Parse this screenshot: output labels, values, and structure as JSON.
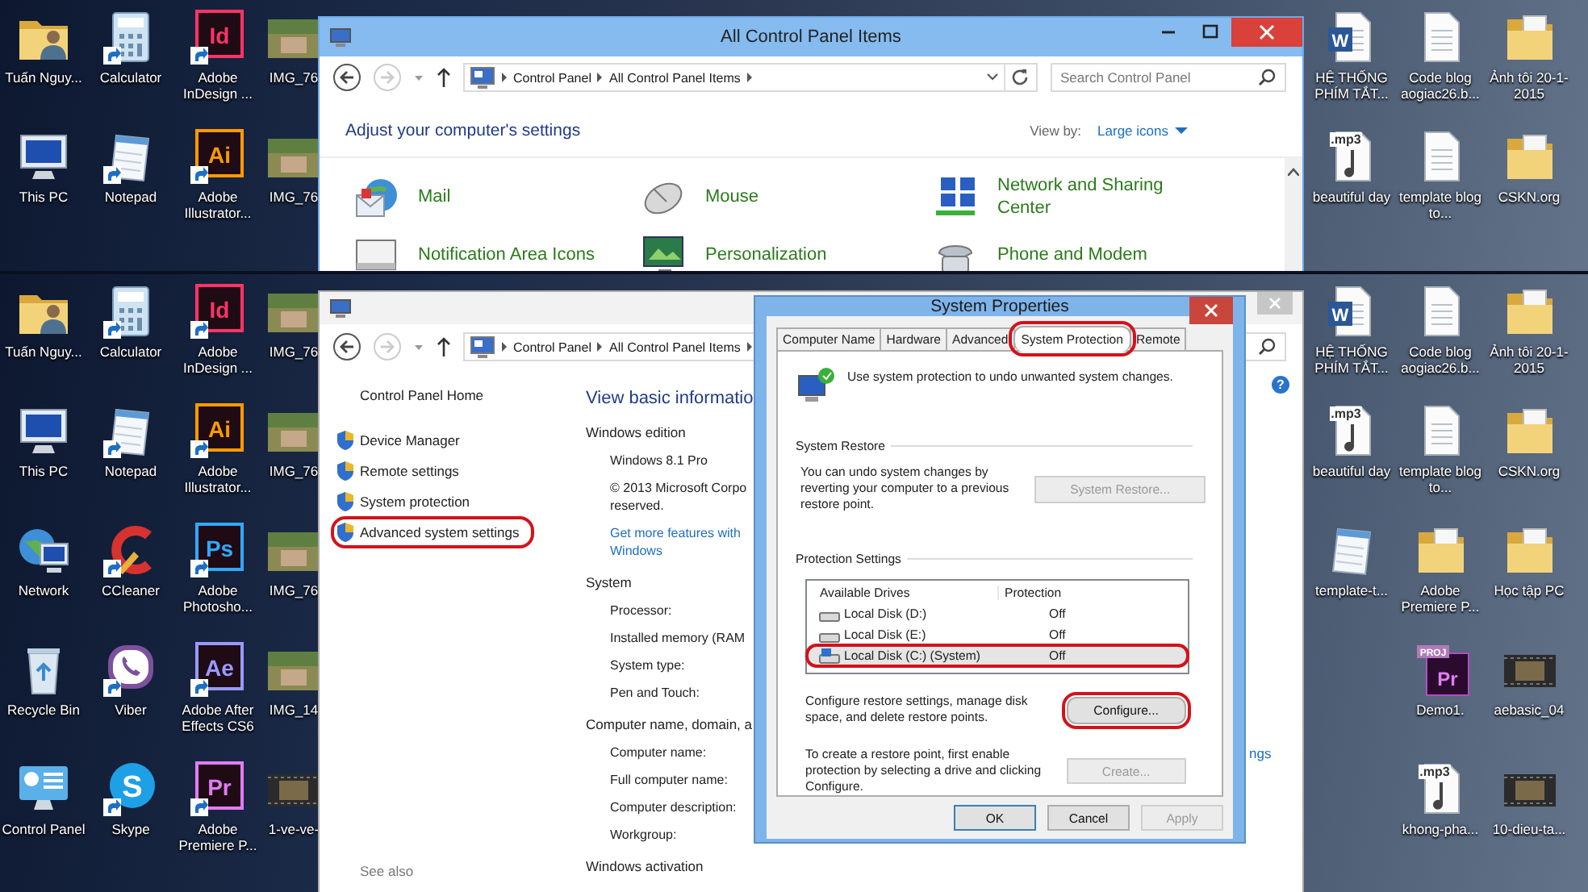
{
  "top_screen": {
    "desktop_left_columns": [
      [
        {
          "label": "Tuấn Nguy...",
          "kind": "user-folder",
          "shortcut": false
        },
        {
          "label": "This PC",
          "kind": "computer",
          "shortcut": false
        }
      ],
      [
        {
          "label": "Calculator",
          "kind": "calculator",
          "shortcut": true
        },
        {
          "label": "Notepad",
          "kind": "notepad",
          "shortcut": true
        }
      ],
      [
        {
          "label": "Adobe InDesign ...",
          "kind": "app-tile",
          "badge": "Id",
          "color": "#ff3366",
          "shortcut": true
        },
        {
          "label": "Adobe Illustrator...",
          "kind": "app-tile",
          "badge": "Ai",
          "color": "#ff9a00",
          "shortcut": true
        }
      ],
      [
        {
          "label": "IMG_76",
          "kind": "photo",
          "shortcut": false
        },
        {
          "label": "IMG_76",
          "kind": "photo",
          "shortcut": false
        }
      ]
    ],
    "desktop_right_columns": [
      [
        {
          "label": "HỆ THỐNG PHÍM TẮT...",
          "kind": "word-doc",
          "badge": "W",
          "shortcut": false
        },
        {
          "label": "beautiful day",
          "kind": "audio-file",
          "badge": ".mp3",
          "shortcut": false
        }
      ],
      [
        {
          "label": "Code blog aogiac26.b...",
          "kind": "text-file",
          "shortcut": false
        },
        {
          "label": "template blog to...",
          "kind": "text-file",
          "shortcut": false
        }
      ],
      [
        {
          "label": "Ảnh tôi 20-1-2015",
          "kind": "folder",
          "shortcut": false
        },
        {
          "label": "CSKN.org",
          "kind": "folder",
          "shortcut": false
        }
      ]
    ],
    "window": {
      "title": "All Control Panel Items",
      "breadcrumb": [
        "Control Panel",
        "All Control Panel Items"
      ],
      "search": {
        "placeholder": "Search Control Panel"
      },
      "heading": "Adjust your computer's settings",
      "view_by_label": "View by:",
      "view_by_value": "Large icons",
      "items": [
        {
          "label": "Mail",
          "kind": "mail"
        },
        {
          "label": "Mouse",
          "kind": "mouse"
        },
        {
          "label": "Network and Sharing Center",
          "kind": "network"
        },
        {
          "label": "Notification Area Icons",
          "kind": "notification"
        },
        {
          "label": "Personalization",
          "kind": "personalization"
        },
        {
          "label": "Phone and Modem",
          "kind": "phone"
        }
      ]
    }
  },
  "bottom_screen": {
    "desktop_left_columns": [
      [
        {
          "label": "Tuấn Nguy...",
          "kind": "user-folder",
          "shortcut": false
        },
        {
          "label": "This PC",
          "kind": "computer",
          "shortcut": false
        },
        {
          "label": "Network",
          "kind": "network",
          "shortcut": false
        },
        {
          "label": "Recycle Bin",
          "kind": "recycle-bin",
          "shortcut": false
        },
        {
          "label": "Control Panel",
          "kind": "control-panel",
          "shortcut": false
        }
      ],
      [
        {
          "label": "Calculator",
          "kind": "calculator",
          "shortcut": true
        },
        {
          "label": "Notepad",
          "kind": "notepad",
          "shortcut": true
        },
        {
          "label": "CCleaner",
          "kind": "ccleaner",
          "shortcut": true
        },
        {
          "label": "Viber",
          "kind": "viber",
          "shortcut": true
        },
        {
          "label": "Skype",
          "kind": "skype",
          "badge": "S",
          "shortcut": true
        }
      ],
      [
        {
          "label": "Adobe InDesign ...",
          "kind": "app-tile",
          "badge": "Id",
          "color": "#ff3366",
          "shortcut": true
        },
        {
          "label": "Adobe Illustrator...",
          "kind": "app-tile",
          "badge": "Ai",
          "color": "#ff9a00",
          "shortcut": true
        },
        {
          "label": "Adobe Photosho...",
          "kind": "app-tile",
          "badge": "Ps",
          "color": "#31a8ff",
          "shortcut": true
        },
        {
          "label": "Adobe After Effects CS6",
          "kind": "app-tile",
          "badge": "Ae",
          "color": "#9999ff",
          "shortcut": true
        },
        {
          "label": "Adobe Premiere P...",
          "kind": "app-tile",
          "badge": "Pr",
          "color": "#e27cf5",
          "shortcut": true
        }
      ],
      [
        {
          "label": "IMG_76",
          "kind": "photo",
          "shortcut": false
        },
        {
          "label": "IMG_76",
          "kind": "photo",
          "shortcut": false
        },
        {
          "label": "IMG_76",
          "kind": "photo",
          "shortcut": false
        },
        {
          "label": "IMG_14",
          "kind": "photo",
          "shortcut": false
        },
        {
          "label": "1-ve-ve-",
          "kind": "video",
          "shortcut": false
        }
      ]
    ],
    "desktop_right_columns": [
      [
        {
          "label": "HỆ THỐNG PHÍM TẮT...",
          "kind": "word-doc",
          "badge": "W",
          "shortcut": false
        },
        {
          "label": "beautiful day",
          "kind": "audio-file",
          "badge": ".mp3",
          "shortcut": false
        },
        {
          "label": "template-t...",
          "kind": "notepad",
          "shortcut": false
        }
      ],
      [
        {
          "label": "Code blog aogiac26.b...",
          "kind": "text-file",
          "shortcut": false
        },
        {
          "label": "template blog to...",
          "kind": "text-file",
          "shortcut": false
        },
        {
          "label": "Adobe Premiere P...",
          "kind": "folder",
          "shortcut": false
        },
        {
          "label": "Demo1.",
          "kind": "premiere-project",
          "badge": "Pr",
          "tag": "PROJ",
          "shortcut": false
        },
        {
          "label": "khong-pha...",
          "kind": "audio-file",
          "badge": ".mp3",
          "shortcut": false
        }
      ],
      [
        {
          "label": "Ảnh tôi 20-1-2015",
          "kind": "folder",
          "shortcut": false
        },
        {
          "label": "CSKN.org",
          "kind": "folder",
          "shortcut": false
        },
        {
          "label": "Học tập PC",
          "kind": "folder",
          "shortcut": false
        },
        {
          "label": "aebasic_04",
          "kind": "video",
          "shortcut": false
        },
        {
          "label": "10-dieu-ta...",
          "kind": "video",
          "shortcut": false
        }
      ]
    ],
    "system_window": {
      "breadcrumb": [
        "Control Panel",
        "All Control Panel Items"
      ],
      "nav_home": "Control Panel Home",
      "nav_items": [
        {
          "label": "Device Manager",
          "circled": false
        },
        {
          "label": "Remote settings",
          "circled": false
        },
        {
          "label": "System protection",
          "circled": false
        },
        {
          "label": "Advanced system settings",
          "circled": true
        }
      ],
      "see_also": "See also",
      "heading": "View basic informatio",
      "sections": [
        {
          "title": "Windows edition",
          "rows": [
            {
              "kind": "text",
              "text": "Windows 8.1 Pro"
            },
            {
              "kind": "text",
              "text": "© 2013 Microsoft Corpo"
            },
            {
              "kind": "text-wrap",
              "text": "reserved."
            },
            {
              "kind": "link",
              "text": "Get more features with"
            },
            {
              "kind": "link-wrap",
              "text": "Windows"
            }
          ]
        },
        {
          "title": "System",
          "rows": [
            {
              "kind": "text",
              "text": "Processor:"
            },
            {
              "kind": "text",
              "text": "Installed memory (RAM"
            },
            {
              "kind": "text",
              "text": "System type:"
            },
            {
              "kind": "text",
              "text": "Pen and Touch:"
            }
          ]
        },
        {
          "title": "Computer name, domain, a",
          "rows": [
            {
              "kind": "text",
              "text": "Computer name:"
            },
            {
              "kind": "text",
              "text": "Full computer name:"
            },
            {
              "kind": "text",
              "text": "Computer description:"
            },
            {
              "kind": "text",
              "text": "Workgroup:"
            }
          ]
        },
        {
          "title": "Windows activation"
        }
      ],
      "help_glyph": "?",
      "side_link": "ngs"
    },
    "dialog": {
      "title": "System Properties",
      "tabs": [
        {
          "label": "Computer Name",
          "selected": false,
          "circled": false
        },
        {
          "label": "Hardware",
          "selected": false,
          "circled": false
        },
        {
          "label": "Advanced",
          "selected": false,
          "circled": false
        },
        {
          "label": "System Protection",
          "selected": true,
          "circled": true
        },
        {
          "label": "Remote",
          "selected": false,
          "circled": false
        }
      ],
      "intro": "Use system protection to undo unwanted system changes.",
      "restore_group": "System Restore",
      "restore_text": "You can undo system changes by reverting your computer to a previous restore point.",
      "restore_button": {
        "label": "System Restore...",
        "disabled": true,
        "circled": false
      },
      "protection_group": "Protection Settings",
      "columns": [
        "Available Drives",
        "Protection"
      ],
      "drives": [
        {
          "name": "Local Disk (D:)",
          "protection": "Off",
          "kind": "disk",
          "selected": false,
          "circled": false
        },
        {
          "name": "Local Disk (E:)",
          "protection": "Off",
          "kind": "disk",
          "selected": false,
          "circled": false
        },
        {
          "name": "Local Disk (C:) (System)",
          "protection": "Off",
          "kind": "system-disk",
          "selected": true,
          "circled": true
        }
      ],
      "configure_text": "Configure restore settings, manage disk space, and delete restore points.",
      "configure_button": {
        "label": "Configure...",
        "disabled": false,
        "circled": true
      },
      "create_text": "To create a restore point, first enable protection by selecting a drive and clicking Configure.",
      "create_button": {
        "label": "Create...",
        "disabled": true,
        "circled": false
      },
      "footer_buttons": [
        {
          "label": "OK",
          "disabled": false
        },
        {
          "label": "Cancel",
          "disabled": false
        },
        {
          "label": "Apply",
          "disabled": true
        }
      ]
    }
  }
}
